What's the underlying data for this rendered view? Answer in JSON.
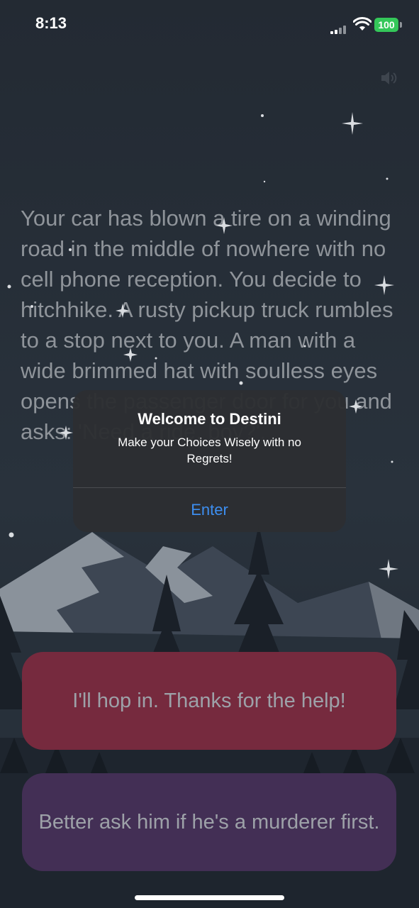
{
  "status_bar": {
    "time": "8:13",
    "battery": "100"
  },
  "story": {
    "text": "Your car has blown a tire on a winding road in the middle of nowhere with no cell phone reception. You decide to hitchhike. A rusty pickup truck rumbles to a stop next to you. A man with a wide brimmed hat with soulless eyes opens the passenger door for you and asks: 'Need a ride, boy?'."
  },
  "choices": {
    "choice1": "I'll hop in. Thanks for the help!",
    "choice2": "Better ask him if he's a murderer first."
  },
  "alert": {
    "title": "Welcome to Destini",
    "message": "Make your Choices Wisely with no Regrets!",
    "button": "Enter"
  },
  "icons": {
    "sound": "speaker-icon",
    "signal": "cellular-signal-icon",
    "wifi": "wifi-icon",
    "battery": "battery-icon"
  },
  "colors": {
    "choice1_bg": "#762a3e",
    "choice2_bg": "#432f55",
    "alert_button": "#3d8ef0",
    "battery": "#34c759"
  }
}
